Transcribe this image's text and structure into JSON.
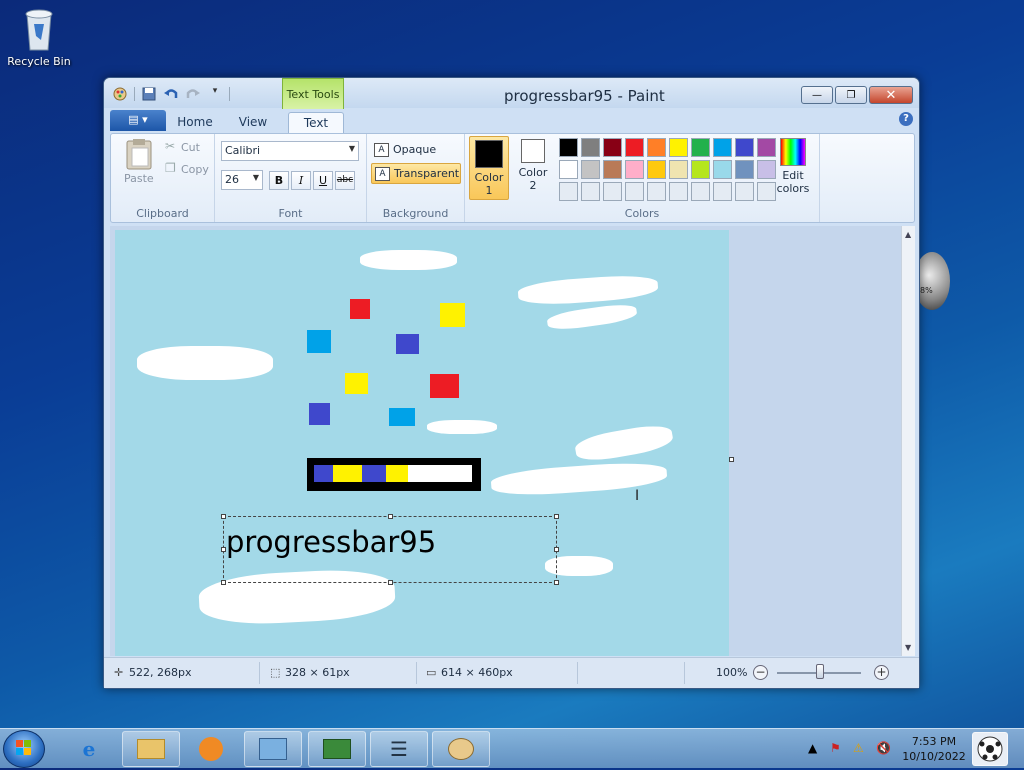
{
  "desktop": {
    "recycle_bin_label": "Recycle Bin",
    "gadget_text": "8%"
  },
  "window": {
    "title": "progressbar95 - Paint",
    "context_tab_label": "Text Tools",
    "minimize_glyph": "—",
    "maximize_glyph": "❐",
    "close_glyph": "✕"
  },
  "ribbon_tabs": {
    "file_glyph": "▤ ▾",
    "home": "Home",
    "view": "View",
    "text": "Text",
    "help_glyph": "?"
  },
  "clipboard": {
    "paste": "Paste",
    "cut": "Cut",
    "copy": "Copy",
    "group_label": "Clipboard"
  },
  "font": {
    "family_value": "Calibri",
    "size_value": "26",
    "bold": "B",
    "italic": "I",
    "underline": "U",
    "strike": "abc",
    "group_label": "Font"
  },
  "background": {
    "opaque": "Opaque",
    "transparent": "Transparent",
    "group_label": "Background"
  },
  "colors": {
    "color1_label_line1": "Color",
    "color1_label_line2": "1",
    "color2_label_line1": "Color",
    "color2_label_line2": "2",
    "edit_colors_line1": "Edit",
    "edit_colors_line2": "colors",
    "group_label": "Colors",
    "color1_value": "#000000",
    "color2_value": "#ffffff",
    "palette_row1": [
      "#000000",
      "#7f7f7f",
      "#880015",
      "#ed1c24",
      "#ff7f27",
      "#fff200",
      "#22b14c",
      "#00a2e8",
      "#3f48cc",
      "#a349a4"
    ],
    "palette_row2": [
      "#ffffff",
      "#c3c3c3",
      "#b97a57",
      "#ffaec9",
      "#ffc90e",
      "#efe4b0",
      "#b5e61d",
      "#99d9ea",
      "#7092be",
      "#c8bfe7"
    ]
  },
  "canvas": {
    "text_content": "progressbar95",
    "background_color": "#a3d9e8"
  },
  "status": {
    "cursor_pos": "522, 268px",
    "selection_size": "328 × 61px",
    "image_size": "614 × 460px",
    "zoom": "100%",
    "zoom_minus": "−",
    "zoom_plus": "+"
  },
  "taskbar": {
    "time": "7:53 PM",
    "date": "10/10/2022"
  }
}
